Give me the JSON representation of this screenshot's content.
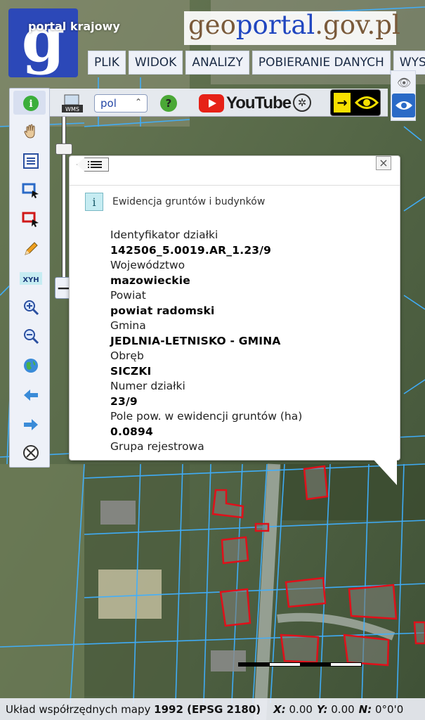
{
  "header": {
    "logo_letter": "g",
    "subtitle": "portal krajowy",
    "brand_prefix": "geo",
    "brand_main": "portal",
    "brand_suffix": ".gov.pl"
  },
  "menu": [
    "PLIK",
    "WIDOK",
    "ANALIZY",
    "POBIERANIE DANYCH",
    "WYS"
  ],
  "toolbar": {
    "wms_label": "WMS",
    "language": "pol",
    "help_label": "?",
    "youtube_label": "YouTube",
    "vision_arrow": "→"
  },
  "left_tools": [
    {
      "name": "info-icon"
    },
    {
      "name": "pan-hand-icon"
    },
    {
      "name": "legend-table-icon"
    },
    {
      "name": "select-blue-rect-icon"
    },
    {
      "name": "select-red-rect-icon"
    },
    {
      "name": "pencil-icon"
    },
    {
      "name": "xyh-icon",
      "label": "XYH"
    },
    {
      "name": "zoom-in-icon"
    },
    {
      "name": "zoom-out-icon"
    },
    {
      "name": "globe-icon"
    },
    {
      "name": "arrow-back-icon"
    },
    {
      "name": "arrow-forward-icon"
    },
    {
      "name": "cancel-circle-icon"
    }
  ],
  "zoom": {
    "minus_label": "−"
  },
  "popup": {
    "close_label": "×",
    "title": "Ewidencja gruntów i budynków",
    "fields": [
      {
        "label": "Identyfikator działki",
        "value": "142506_5.0019.AR_1.23/9"
      },
      {
        "label": "Województwo",
        "value": "mazowieckie"
      },
      {
        "label": "Powiat",
        "value": "powiat radomski"
      },
      {
        "label": "Gmina",
        "value": "JEDLNIA-LETNISKO - GMINA"
      },
      {
        "label": "Obręb",
        "value": "SICZKI"
      },
      {
        "label": "Numer działki",
        "value": "23/9"
      },
      {
        "label": "Pole pow. w ewidencji gruntów (ha)",
        "value": "0.0894"
      },
      {
        "label": "Grupa rejestrowa",
        "value": ""
      }
    ]
  },
  "statusbar": {
    "prefix": "Układ współrzędnych mapy",
    "crs": "1992 (EPSG 2180)",
    "x_label": "X:",
    "x_value": "0.00",
    "y_label": "Y:",
    "y_value": "0.00",
    "n_label": "N:",
    "n_value": "0°0'0"
  },
  "colors": {
    "logo_bg": "#2c48b8",
    "parcel_line": "#3fb0ff",
    "building_outline": "#e0101a",
    "menu_bg": "#eef1f8"
  }
}
